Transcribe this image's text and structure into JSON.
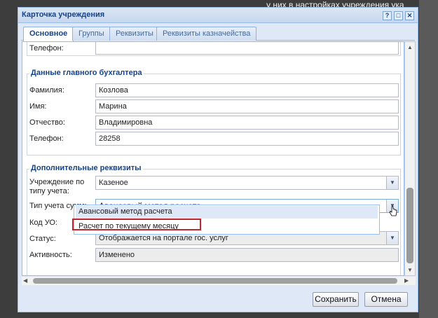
{
  "background": {
    "text": "у них в настройках учреждения ука"
  },
  "window": {
    "title": "Карточка учреждения",
    "tools": {
      "help": "?",
      "maximize": "□",
      "close": "✕"
    }
  },
  "tabs": [
    {
      "label": "Основное"
    },
    {
      "label": "Группы"
    },
    {
      "label": "Реквизиты"
    },
    {
      "label": "Реквизиты казначейства"
    }
  ],
  "top_section": {
    "phone_label": "Телефон:",
    "phone_value": ""
  },
  "accountant": {
    "title": "Данные главного бухгалтера",
    "last_name_label": "Фамилия:",
    "last_name": "Козлова",
    "first_name_label": "Имя:",
    "first_name": "Марина",
    "patronymic_label": "Отчество:",
    "patronymic": "Владимировна",
    "phone_label": "Телефон:",
    "phone": "28258"
  },
  "additional": {
    "title": "Дополнительные реквизиты",
    "type_label_1": "Учреждение по",
    "type_label_2": "типу учета:",
    "type_value": "Казеное",
    "sum_type_label": "Тип учета сумм:",
    "sum_type_value": "Авансовый метод расчета",
    "code_label": "Код УО:",
    "status_label": "Статус:",
    "status_value": "Отображается на портале гос. услуг",
    "activity_label": "Активность:",
    "activity_value": "Изменено"
  },
  "dropdown": {
    "options": [
      "Авансовый метод расчета",
      "Расчет по текущему месяцу"
    ]
  },
  "footer": {
    "save_label": "Сохранить",
    "cancel_label": "Отмена"
  },
  "colors": {
    "header_text": "#15428b",
    "highlight": "#c0272d",
    "window_bg": "#dfe8f6"
  }
}
